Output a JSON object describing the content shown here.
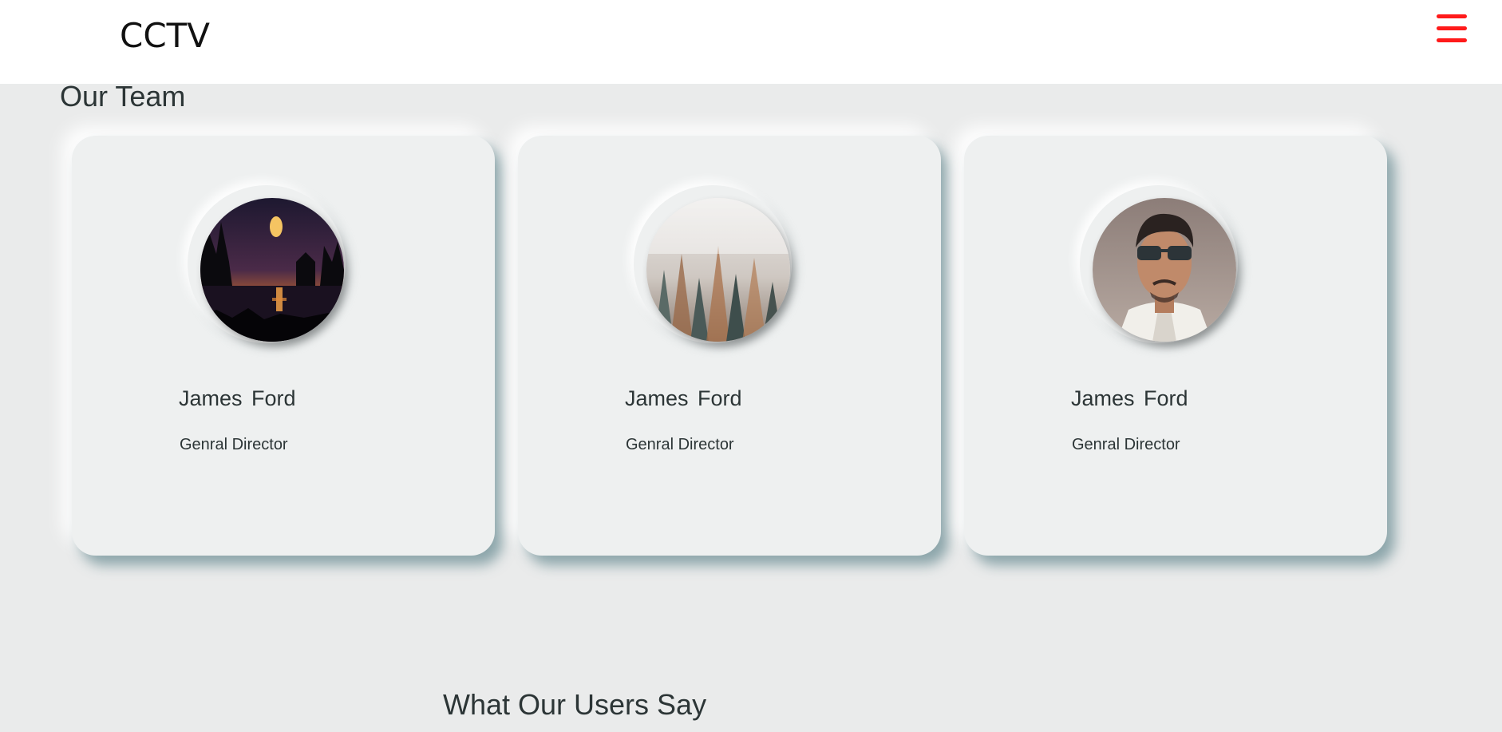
{
  "navbar": {
    "brand": "CCTV",
    "menu_icon": "hamburger-menu-icon",
    "menu_color": "#ff1a1a"
  },
  "team": {
    "title": "Our Team",
    "members": [
      {
        "name": "James Ford",
        "role": "Genral Director",
        "photo": "night-lake-sunset-photo"
      },
      {
        "name": "James Ford",
        "role": "Genral Director",
        "photo": "misty-forest-photo"
      },
      {
        "name": "James Ford",
        "role": "Genral Director",
        "photo": "man-with-sunglasses-photo"
      }
    ]
  },
  "testimonials": {
    "title": "What Our Users Say"
  }
}
